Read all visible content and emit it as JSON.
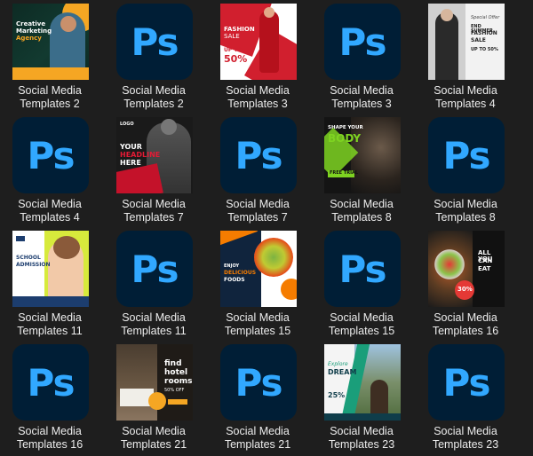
{
  "files": [
    {
      "line1": "Social Media",
      "line2": "Templates 2",
      "kind": "image",
      "art": "marketing"
    },
    {
      "line1": "Social Media",
      "line2": "Templates 2",
      "kind": "ps"
    },
    {
      "line1": "Social Media",
      "line2": "Templates 3",
      "kind": "image",
      "art": "fashion-red"
    },
    {
      "line1": "Social Media",
      "line2": "Templates 3",
      "kind": "ps"
    },
    {
      "line1": "Social Media",
      "line2": "Templates 4",
      "kind": "image",
      "art": "fashion-gray"
    },
    {
      "line1": "Social Media",
      "line2": "Templates 4",
      "kind": "ps"
    },
    {
      "line1": "Social Media",
      "line2": "Templates 7",
      "kind": "image",
      "art": "fitness-red"
    },
    {
      "line1": "Social Media",
      "line2": "Templates 7",
      "kind": "ps"
    },
    {
      "line1": "Social Media",
      "line2": "Templates 8",
      "kind": "image",
      "art": "gym-green"
    },
    {
      "line1": "Social Media",
      "line2": "Templates 8",
      "kind": "ps"
    },
    {
      "line1": "Social Media",
      "line2": "Templates 11",
      "kind": "image",
      "art": "school"
    },
    {
      "line1": "Social Media",
      "line2": "Templates 11",
      "kind": "ps"
    },
    {
      "line1": "Social Media",
      "line2": "Templates 15",
      "kind": "image",
      "art": "food-orange"
    },
    {
      "line1": "Social Media",
      "line2": "Templates 15",
      "kind": "ps"
    },
    {
      "line1": "Social Media",
      "line2": "Templates 16",
      "kind": "image",
      "art": "food-dark"
    },
    {
      "line1": "Social Media",
      "line2": "Templates 16",
      "kind": "ps"
    },
    {
      "line1": "Social Media",
      "line2": "Templates 21",
      "kind": "image",
      "art": "hotel"
    },
    {
      "line1": "Social Media",
      "line2": "Templates 21",
      "kind": "ps"
    },
    {
      "line1": "Social Media",
      "line2": "Templates 23",
      "kind": "image",
      "art": "travel"
    },
    {
      "line1": "Social Media",
      "line2": "Templates 23",
      "kind": "ps"
    }
  ],
  "ps_label": "Ps",
  "thumb_text": {
    "marketing": {
      "line1": "Creative",
      "line2": "Marketing",
      "line3": "Agency"
    },
    "fashion_red": {
      "line1": "FASHION",
      "line2": "SALE",
      "line3": "UP TO",
      "line4": "50%"
    },
    "fashion_gray": {
      "line1": "Special Offer",
      "line2": "END SUMMER",
      "line3": "FASHION",
      "line4": "SALE",
      "line5": "UP TO 50%"
    },
    "fitness_red": {
      "line1": "LOGO",
      "line2": "YOUR",
      "line3": "HEADLINE",
      "line4": "HERE"
    },
    "gym_green": {
      "line1": "SHAPE YOUR",
      "line2": "BODY",
      "line3": "FREE TRIAL"
    },
    "school": {
      "line1": "SCHOOL",
      "line2": "ADMISSION"
    },
    "food_orange": {
      "line1": "ENJOY",
      "line2": "DELICIOUS",
      "line3": "FOODS"
    },
    "food_dark": {
      "line1": "ALL YOU",
      "line2": "CAN",
      "line3": "EAT",
      "line4": "30%"
    },
    "hotel": {
      "line1": "find",
      "line2": "hotel",
      "line3": "rooms",
      "line4": "50% OFF"
    },
    "travel": {
      "line1": "Explore",
      "line2": "DREAM",
      "line3": "25%"
    }
  }
}
